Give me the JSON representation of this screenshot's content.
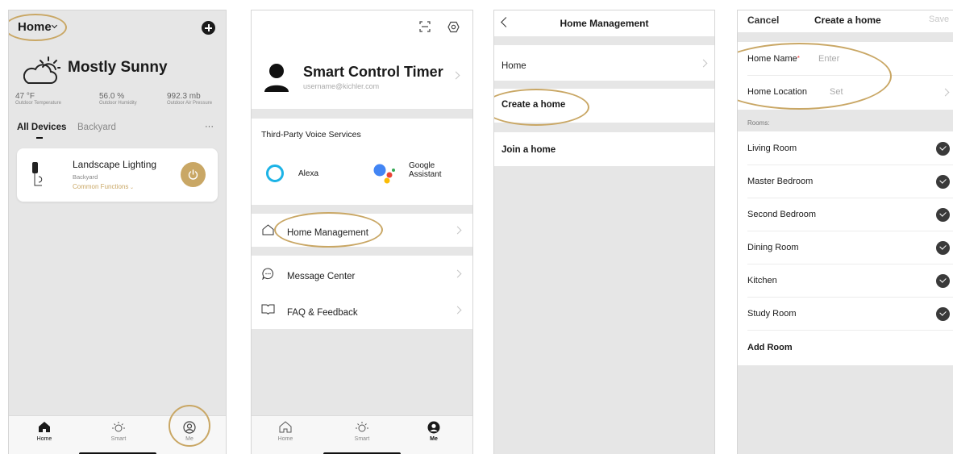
{
  "colors": {
    "accent_gold": "#c9a765",
    "dark_check": "#3a3a3a",
    "gray_bg": "#e6e6e6"
  },
  "panel1": {
    "home_label": "Home",
    "weather": {
      "condition": "Mostly Sunny",
      "temp_value": "47 °F",
      "temp_label": "Outdoor Temperature",
      "humidity_value": "56.0 %",
      "humidity_label": "Outdoor Humidity",
      "pressure_value": "992.3 mb",
      "pressure_label": "Outdoor Air Pressure"
    },
    "tabs": {
      "all_devices": "All Devices",
      "backyard": "Backyard",
      "more": "···"
    },
    "device": {
      "name": "Landscape Lighting",
      "room": "Backyard",
      "functions": "Common Functions"
    },
    "nav": {
      "home": "Home",
      "smart": "Smart",
      "me": "Me"
    }
  },
  "panel2": {
    "profile": {
      "name": "Smart Control Timer",
      "email": "username@kichler.com"
    },
    "voice_section": "Third-Party Voice Services",
    "alexa": "Alexa",
    "google_line1": "Google",
    "google_line2": "Assistant",
    "menu": {
      "home_management": "Home Management",
      "message_center": "Message Center",
      "faq": "FAQ & Feedback"
    },
    "nav": {
      "home": "Home",
      "smart": "Smart",
      "me": "Me"
    }
  },
  "panel3": {
    "title": "Home Management",
    "home_item": "Home",
    "create_home": "Create a home",
    "join_home": "Join a home"
  },
  "panel4": {
    "cancel": "Cancel",
    "title": "Create a home",
    "save": "Save",
    "home_name_label": "Home Name",
    "home_name_required": "*",
    "home_name_placeholder": "Enter",
    "home_location_label": "Home Location",
    "home_location_value": "Set",
    "rooms_header": "Rooms:",
    "rooms": [
      "Living Room",
      "Master Bedroom",
      "Second Bedroom",
      "Dining Room",
      "Kitchen",
      "Study Room"
    ],
    "add_room": "Add Room"
  }
}
